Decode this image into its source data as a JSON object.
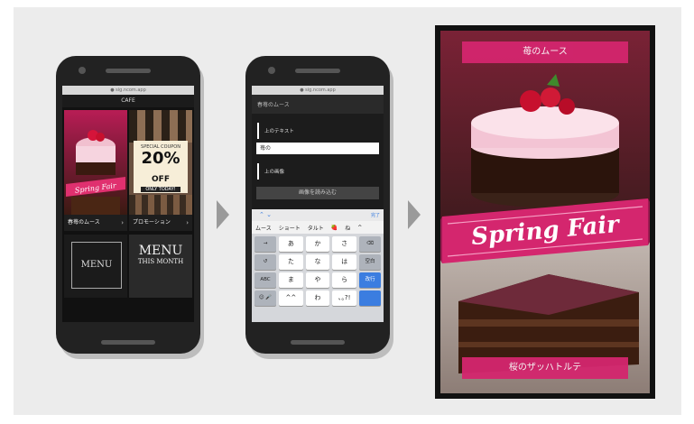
{
  "phone1": {
    "url": "● sig.ncom.app",
    "app_title": "CAFE",
    "tiles": [
      {
        "caption": "春苺のムース",
        "chev": "›"
      },
      {
        "caption": "プロモーション",
        "chev": "›"
      }
    ],
    "coupon": {
      "line1": "SPECIAL COUPON",
      "big": "20%",
      "off": "OFF",
      "line3": "ONLY TODAY!"
    },
    "mini_ribbon": "Spring Fair",
    "menu_card": {
      "line1": "MENU",
      "line2": "THIS MONTH"
    },
    "blackboard_text": "MENU"
  },
  "phone2": {
    "url": "● sig.ncom.app",
    "form_title": "春苺のムース",
    "section_text_label": "上のテキスト",
    "text_value": "苺の",
    "section_image_label": "上の画像",
    "upload_button": "画像を読み込む",
    "keyboard": {
      "done": "完了",
      "candidates": [
        "ムース",
        "ショート",
        "タルト",
        "🍓",
        "ね",
        "^"
      ],
      "rows": [
        {
          "left": "→",
          "keys": [
            "あ",
            "か",
            "さ"
          ],
          "right": "⌫"
        },
        {
          "left": "↺",
          "keys": [
            "た",
            "な",
            "は"
          ],
          "right": "空白"
        },
        {
          "left": "ABC",
          "keys": [
            "ま",
            "や",
            "ら"
          ],
          "right": "改行"
        },
        {
          "left": "☺ 🎤",
          "keys": [
            "^^",
            "わ",
            "､｡?!"
          ],
          "right": ""
        }
      ]
    }
  },
  "tablet": {
    "top_banner": "苺のムース",
    "ribbon": "Spring Fair",
    "bottom_banner": "桜のザッハトルテ"
  },
  "colors": {
    "accent_pink": "#d4266e",
    "keyboard_blue": "#3b7de0",
    "arrow_gray": "#9a9a9a"
  }
}
